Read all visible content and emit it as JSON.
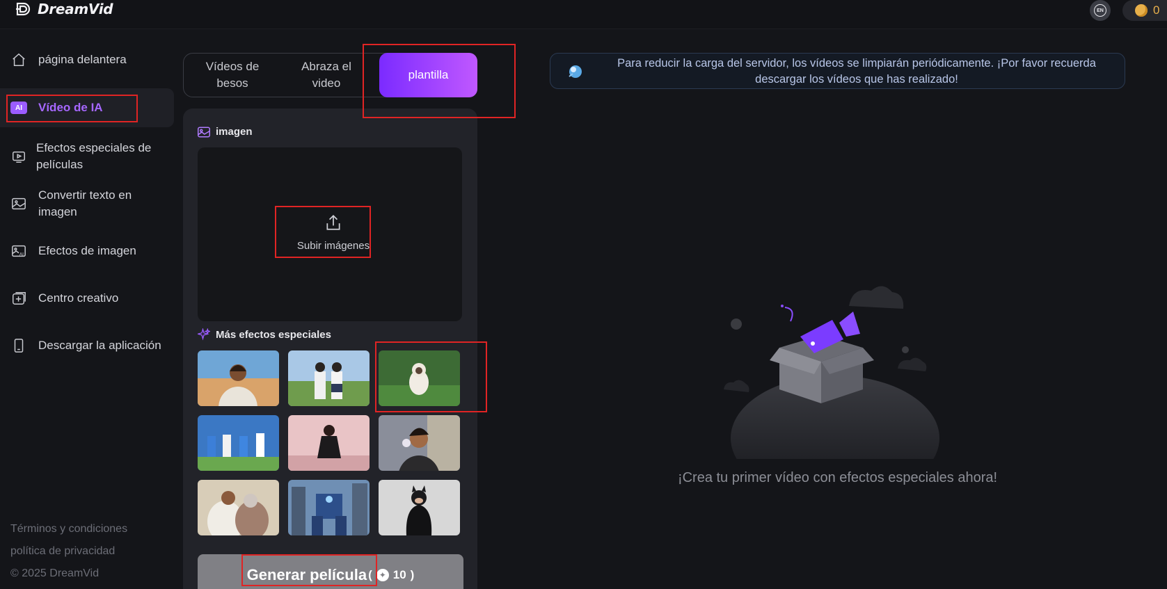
{
  "app": {
    "name": "DreamVid"
  },
  "header": {
    "language_badge": "EN",
    "coin_count": "0"
  },
  "sidebar": {
    "items": [
      {
        "label": "página delantera",
        "icon": "home-icon"
      },
      {
        "label": "Vídeo de IA",
        "icon": "ai-video-icon",
        "active": true
      },
      {
        "label": "Efectos especiales de películas",
        "icon": "movie-effects-icon"
      },
      {
        "label": "Convertir texto en imagen",
        "icon": "text-to-image-icon"
      },
      {
        "label": "Efectos de imagen",
        "icon": "image-effects-icon"
      },
      {
        "label": "Centro creativo",
        "icon": "creative-center-icon"
      },
      {
        "label": "Descargar la aplicación",
        "icon": "phone-icon"
      }
    ],
    "footer": {
      "terms": "Términos y condiciones",
      "privacy": "política de privacidad",
      "copyright": "© 2025 DreamVid"
    }
  },
  "tabs": [
    {
      "label": "Vídeos de besos"
    },
    {
      "label": "Abraza el video"
    },
    {
      "label": "plantilla",
      "active": true
    }
  ],
  "panel": {
    "image_section_title": "imagen",
    "upload_label": "Subir imágenes",
    "effects_section_title": "Más efectos especiales",
    "effects_count": 9,
    "generate_label": "Generar película",
    "generate_cost": "10"
  },
  "notice": {
    "text": "Para reducir la carga del servidor, los vídeos se limpiarán periódicamente. ¡Por favor recuerda descargar los vídeos que has realizado!"
  },
  "empty_state": {
    "text": "¡Crea tu primer vídeo con efectos especiales ahora!"
  },
  "colors": {
    "accent": "#9b5cff",
    "tab_gradient_start": "#7b2bff",
    "tab_gradient_end": "#c058ff",
    "annotation_red": "#e02424",
    "coin": "#e9b04c"
  }
}
